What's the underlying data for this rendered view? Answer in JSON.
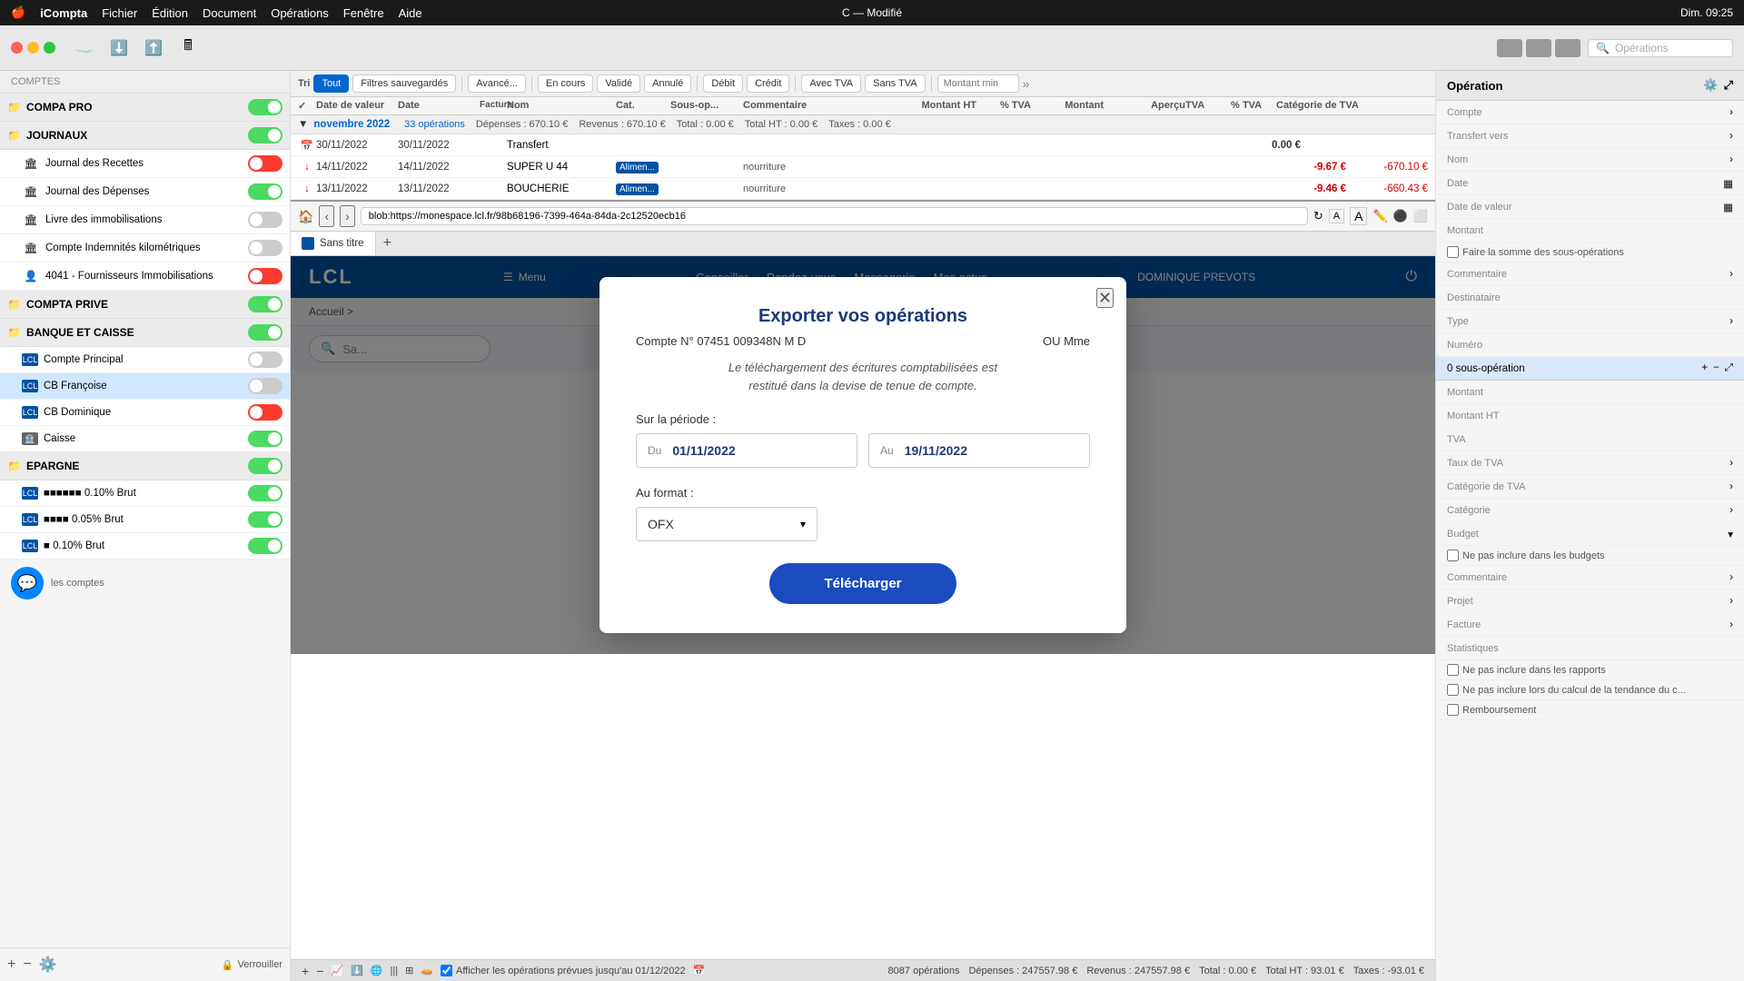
{
  "menubar": {
    "apple": "🍎",
    "app_name": "iCompta",
    "menus": [
      "Fichier",
      "Édition",
      "Document",
      "Opérations",
      "Fenêtre",
      "Aide"
    ],
    "time": "Dim. 09:25",
    "window_title": "C — Modifié"
  },
  "toolbar": {
    "window_title": "C — Modifié",
    "segments_label": "Operations",
    "search_placeholder": "Opérations"
  },
  "sidebar": {
    "section_label": "Comptes",
    "groups": [
      {
        "name": "COMPA PRO",
        "icon": "📁",
        "toggle": "on",
        "items": []
      },
      {
        "name": "JOURNAUX",
        "icon": "📁",
        "toggle": "on",
        "items": [
          {
            "label": "Journal des Recettes",
            "icon": "🏛",
            "toggle": "off"
          },
          {
            "label": "Journal des Dépenses",
            "icon": "🏛",
            "toggle": "on"
          },
          {
            "label": "Livre des immobilisations",
            "icon": "🏛",
            "toggle": "gray"
          },
          {
            "label": "Compte Indemnités kilométriques",
            "icon": "🏛",
            "toggle": "gray"
          },
          {
            "label": "4041 - Fournisseurs Immobilisations",
            "icon": "👤",
            "toggle": "off"
          }
        ]
      },
      {
        "name": "COMPTA PRIVE",
        "icon": "📁",
        "toggle": "on",
        "items": []
      },
      {
        "name": "BANQUE ET CAISSE",
        "icon": "📁",
        "toggle": "on",
        "items": [
          {
            "label": "Compte Principal",
            "icon": "🏦",
            "toggle": "gray"
          },
          {
            "label": "CB Françoise",
            "icon": "🏦",
            "toggle": "gray",
            "active": true
          },
          {
            "label": "CB Dominique",
            "icon": "🏦",
            "toggle": "off"
          },
          {
            "label": "Caisse",
            "icon": "🏦",
            "toggle": "on"
          }
        ]
      },
      {
        "name": "EPARGNE",
        "icon": "📁",
        "toggle": "on",
        "items": [
          {
            "label": "0.10% Brut",
            "icon": "🏦",
            "toggle": "on"
          },
          {
            "label": "0.05% Brut",
            "icon": "🏦",
            "toggle": "on"
          },
          {
            "label": "0.10% Brut",
            "icon": "🏦",
            "toggle": "on"
          }
        ]
      }
    ],
    "autres_comptes": "les comptes",
    "footer_lock": "Verrouiller"
  },
  "filter_bar": {
    "tri_label": "Tri",
    "buttons": [
      "Tout",
      "Filtres sauvegardés",
      "Avancé...",
      "En cours",
      "Validé",
      "Annulé",
      "Débit",
      "Crédit",
      "Avec TVA",
      "Sans TVA"
    ],
    "montant_min_placeholder": "Montant min"
  },
  "table_header": {
    "check": "✓",
    "date_valeur": "Date de valeur",
    "date": "Date",
    "facture": "Facture",
    "nom": "Nom",
    "cat": "Cat.",
    "sous_op": "Sous-op...",
    "commentaire": "Commentaire",
    "montant_ht": "Montant HT",
    "pct_tva": "% TVA",
    "montant": "Montant",
    "apercu": "Aperçu",
    "tva": "TVA",
    "pct": "% TVA",
    "cat_tva": "Catégorie de TVA"
  },
  "month_group": {
    "label": "novembre 2022",
    "ops_count": "33 opérations",
    "depenses": "Dépenses : 670.10 €",
    "revenus": "Revenus : 670.10 €",
    "total": "Total : 0.00 €",
    "total_ht": "Total HT : 0.00 €",
    "taxes": "Taxes : 0.00 €"
  },
  "transactions": [
    {
      "icon": "📅",
      "date_val": "30/11/2022",
      "date": "30/11/2022",
      "name": "Transfert",
      "cat": "",
      "sous_op": "",
      "commentaire": "",
      "montant": "0.00 €",
      "apercu": "",
      "red": false
    },
    {
      "icon": "↓",
      "date_val": "14/11/2022",
      "date": "14/11/2022",
      "name": "SUPER U 44",
      "cat": "Alimen...",
      "sous_op": "",
      "commentaire": "nourriture",
      "montant": "-9.67 €",
      "apercu": "-670.10 €",
      "red": true
    },
    {
      "icon": "↓",
      "date_val": "13/11/2022",
      "date": "13/11/2022",
      "name": "BOUCHERIE",
      "cat": "Alimen...",
      "sous_op": "",
      "commentaire": "nourriture",
      "montant": "-9.46 €",
      "apercu": "-660.43 €",
      "red": true
    }
  ],
  "browser": {
    "url": "blob:https://monespace.lcl.fr/98b68196-7399-464a-84da-2c12520ecb16",
    "tab_label": "Sans titre",
    "header": {
      "logo": "LCL",
      "menu": "☰ Menu",
      "nav": [
        "Conseiller",
        "Rendez-vous",
        "Messagerie",
        "Mes actus"
      ],
      "user": "DOMINIQUE PREVOTS"
    },
    "breadcrumb": "Accueil >"
  },
  "modal": {
    "title": "Exporter vos opérations",
    "account_left": "Compte N° 07451 009348N M D",
    "account_right": "OU Mme",
    "note": "Le téléchargement des écritures comptabilisées est\nrestitué dans la devise de tenue de compte.",
    "period_label": "Sur la période :",
    "from_label": "Du",
    "from_value": "01/11/2022",
    "to_label": "Au",
    "to_value": "19/11/2022",
    "format_label": "Au format :",
    "format_value": "OFX",
    "download_btn": "Télécharger"
  },
  "right_panel": {
    "title": "Opération",
    "fields": [
      {
        "label": "Compte",
        "value": ""
      },
      {
        "label": "Transfert vers",
        "value": ""
      },
      {
        "label": "Nom",
        "value": ""
      },
      {
        "label": "Date",
        "value": ""
      },
      {
        "label": "Date de valeur",
        "value": ""
      },
      {
        "label": "Montant",
        "value": ""
      }
    ],
    "checkbox_somme": "Faire la somme des sous-opérations",
    "fields2": [
      {
        "label": "Commentaire",
        "value": ""
      },
      {
        "label": "Destinataire",
        "value": ""
      },
      {
        "label": "Type",
        "value": ""
      },
      {
        "label": "Numéro",
        "value": ""
      }
    ],
    "sous_op_label": "0 sous-opération",
    "fields3": [
      {
        "label": "Montant",
        "value": ""
      },
      {
        "label": "Montant HT",
        "value": ""
      },
      {
        "label": "TVA",
        "value": ""
      },
      {
        "label": "Taux de TVA",
        "value": ""
      },
      {
        "label": "Catégorie de TVA",
        "value": ""
      },
      {
        "label": "Catégorie",
        "value": ""
      },
      {
        "label": "Budget",
        "value": ""
      }
    ],
    "checkbox_budget": "Ne pas inclure dans les budgets",
    "fields4": [
      {
        "label": "Commentaire",
        "value": ""
      },
      {
        "label": "Projet",
        "value": ""
      },
      {
        "label": "Facture",
        "value": ""
      },
      {
        "label": "Statistiques",
        "value": ""
      }
    ],
    "checkbox_rapports": "Ne pas inclure dans les rapports",
    "checkbox_tendance": "Ne pas inclure lors du calcul de la tendance du c...",
    "checkbox_remboursement": "Remboursement"
  },
  "status_bar": {
    "ops_count": "8087 opérations",
    "depenses": "Dépenses : 247557.98 €",
    "revenus": "Revenus : 247557.98 €",
    "total": "Total : 0.00 €",
    "total_ht": "Total HT : 93.01 €",
    "taxes": "Taxes : -93.01 €",
    "checkbox_label": "Afficher les opérations prévues jusqu'au 01/12/2022"
  },
  "search": {
    "placeholder": "Sa..."
  }
}
